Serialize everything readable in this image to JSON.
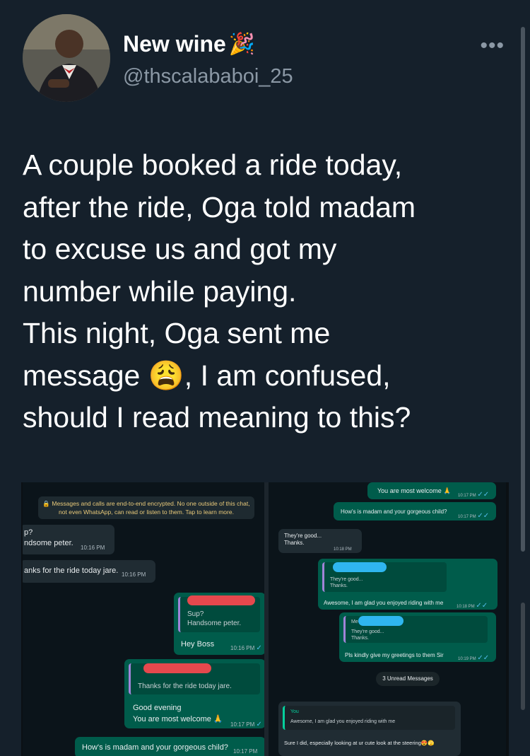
{
  "tweet": {
    "display_name": "New wine",
    "handle": "@thscalababoi_25",
    "text": "A couple booked a ride today,\nafter the ride, Oga told madam\nto excuse us and got my\nnumber while paying.\nThis night, Oga sent me\nmessage 😩, I am confused,\nshould I read meaning to this?",
    "more_label": "•••",
    "name_emoji": "🎉"
  },
  "chat_left": {
    "encryption_note": "🔒 Messages and calls are end-to-end encrypted. No one outside of this chat, not even WhatsApp, can read or listen to them. Tap to learn more.",
    "msg1_line1": "p?",
    "msg1_line2": "ndsome peter.",
    "msg1_time": "10:16 PM",
    "msg2_text": "anks for the ride today jare.",
    "msg2_time": "10:16 PM",
    "reply1_quote_line1": "Sup?",
    "reply1_quote_line2": "Handsome peter.",
    "reply1_text": "Hey Boss",
    "reply1_time": "10:16 PM",
    "reply2_quote": "Thanks for the ride today jare.",
    "reply2_line1": "Good evening",
    "reply2_line2": "You are most welcome 🙏",
    "reply2_time": "10:17 PM",
    "reply3_text": "How's is madam and your gorgeous child?",
    "reply3_time": "10:17 PM"
  },
  "chat_right": {
    "out1_text": "You are most welcome 🙏",
    "out1_time": "10:17 PM",
    "out2_text": "How's is madam and your gorgeous child?",
    "out2_time": "10:17 PM",
    "in1_line1": "They're good...",
    "in1_line2": "Thanks.",
    "in1_time": "10:18 PM",
    "out3_quote_line1": "They're good...",
    "out3_quote_line2": "Thanks.",
    "out3_text": "Awesome, I am glad you enjoyed riding with me",
    "out3_time": "10:18 PM",
    "out4_quote_name": "Me",
    "out4_quote_line1": "They're good...",
    "out4_quote_line2": "Thanks.",
    "out4_text": "Pls kindly give my greetings to them Sir",
    "out4_time": "10:19 PM",
    "unread_label": "3 Unread Messages",
    "in2_quote_name": "You",
    "in2_quote_text": "Awesome, I am glad you enjoyed riding with me",
    "in2_text": "Sure I did, especially looking at ur cute look at the steering😍🫣"
  },
  "colors": {
    "background": "#15202b",
    "chat_background": "#0b141a",
    "outgoing_bubble": "#005c4b",
    "incoming_bubble": "#202c33",
    "read_tick": "#53bdeb"
  }
}
